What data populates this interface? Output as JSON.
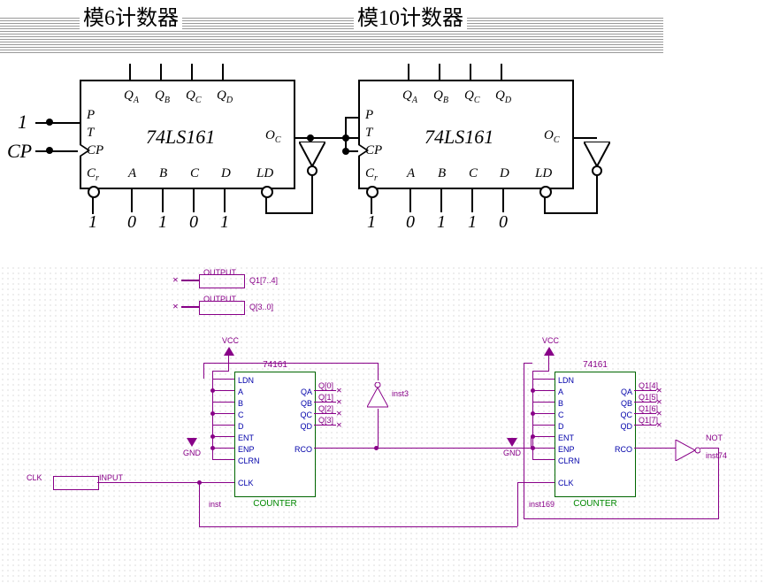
{
  "upper": {
    "title_left": "模6计数器",
    "title_right": "模10计数器",
    "input_1": "1",
    "input_cp": "CP",
    "chip_name": "74LS161",
    "pins_top": [
      "QA",
      "QB",
      "QC",
      "QD"
    ],
    "pins_left": [
      "P",
      "T",
      "CP"
    ],
    "pins_bottom": [
      "Cr",
      "A",
      "B",
      "C",
      "D",
      "LD"
    ],
    "pin_oc": "OC",
    "preset_left": [
      "1",
      "0",
      "1",
      "0",
      "1"
    ],
    "preset_right": [
      "1",
      "0",
      "1",
      "1",
      "0"
    ]
  },
  "lower": {
    "output_hi": "OUTPUT",
    "output_hi_bus": "Q1[7..4]",
    "output_lo": "OUTPUT",
    "output_lo_bus": "Q[3..0]",
    "clk_port": "INPUT",
    "clk_label": "CLK",
    "chip_part": "74161",
    "chip_type": "COUNTER",
    "inst_left": "inst",
    "inst_right": "inst169",
    "inst_inv_l": "inst3",
    "inst_inv_r": "inst74",
    "inv_label": "NOT",
    "vcc": "VCC",
    "gnd": "GND",
    "pins_left": [
      "LDN",
      "A",
      "B",
      "C",
      "D",
      "ENT",
      "ENP",
      "CLRN",
      "CLK"
    ],
    "pins_right": [
      "QA",
      "QB",
      "QC",
      "QD",
      "RCO"
    ],
    "bus_left": [
      "Q[0]",
      "Q[1]",
      "Q[2]",
      "Q[3]"
    ],
    "bus_right": [
      "Q1[4]",
      "Q1[5]",
      "Q1[6]",
      "Q1[7]"
    ]
  }
}
